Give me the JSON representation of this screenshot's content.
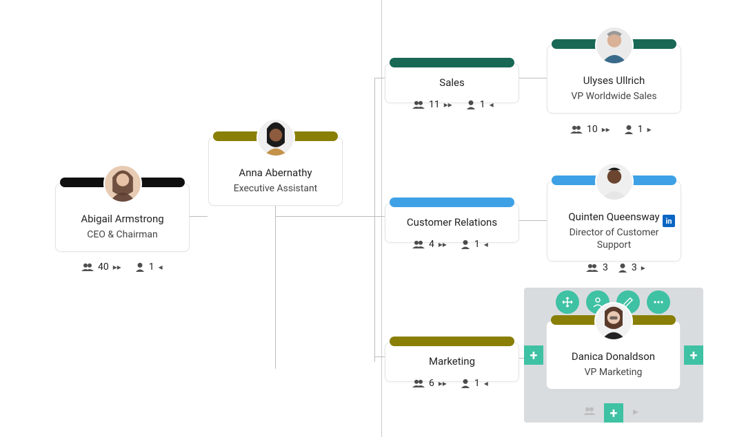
{
  "nodes": {
    "ceo": {
      "name": "Abigail Armstrong",
      "title": "CEO & Chairman",
      "total": 40,
      "direct": 1
    },
    "ea": {
      "name": "Anna Abernathy",
      "title": "Executive Assistant"
    },
    "sales": {
      "name": "Sales",
      "total": 11,
      "direct": 1
    },
    "vpSales": {
      "name": "Ulyses Ullrich",
      "title": "VP Worldwide Sales",
      "total": 10,
      "direct": 1
    },
    "custRel": {
      "name": "Customer Relations",
      "total": 4,
      "direct": 1
    },
    "dirSupport": {
      "name": "Quinten Queensway",
      "title": "Director of Customer Support",
      "total": 3,
      "direct": 3
    },
    "marketing": {
      "name": "Marketing",
      "total": 6,
      "direct": 1
    },
    "vpMarketing": {
      "name": "Danica Donaldson",
      "title": "VP Marketing"
    }
  },
  "colors": {
    "black": "#0f0f0f",
    "olive": "#897f06",
    "teal": "#186855",
    "blue": "#3ea1e6",
    "accent": "#3fc1a4"
  },
  "icons": {
    "group": "group-icon",
    "person": "person-icon",
    "expand": "expand-icon",
    "collapse": "collapse-icon",
    "move": "move-icon",
    "profile": "profile-icon",
    "edit": "edit-icon",
    "more": "more-icon",
    "plus": "plus-icon",
    "linkedin": "linkedin-icon"
  }
}
